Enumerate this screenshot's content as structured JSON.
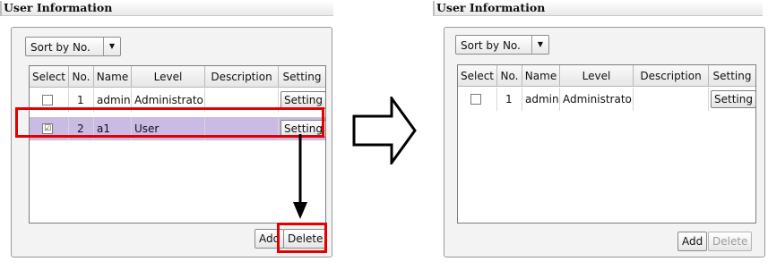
{
  "before_panel": {
    "title": "User Information",
    "sort_label": "Sort by No.",
    "columns": [
      "Select",
      "No.",
      "Name",
      "Level",
      "Description",
      "Setting"
    ],
    "rows": [
      {
        "checked": "",
        "no": "1",
        "name": "admin",
        "level": "Administrator",
        "description": "",
        "setting": "Setting"
      },
      {
        "checked": "☑",
        "no": "2",
        "name": "a1",
        "level": "User",
        "description": "",
        "setting": "Setting"
      }
    ],
    "add_label": "Add",
    "delete_label": "Delete"
  },
  "after_panel": {
    "title": "User Information",
    "sort_label": "Sort by No.",
    "columns": [
      "Select",
      "No.",
      "Name",
      "Level",
      "Description",
      "Setting"
    ],
    "rows": [
      {
        "checked": "",
        "no": "1",
        "name": "admin",
        "level": "Administrator",
        "description": "",
        "setting": "Setting"
      }
    ],
    "add_label": "Add",
    "delete_label": "Delete"
  },
  "colors": {
    "highlight": "#e40000",
    "selected_row": "#c9bbe4"
  },
  "icons": {
    "dropdown": "chevron-down-icon",
    "arrow_down": "arrow-down-icon",
    "arrow_right": "arrow-right-icon"
  }
}
